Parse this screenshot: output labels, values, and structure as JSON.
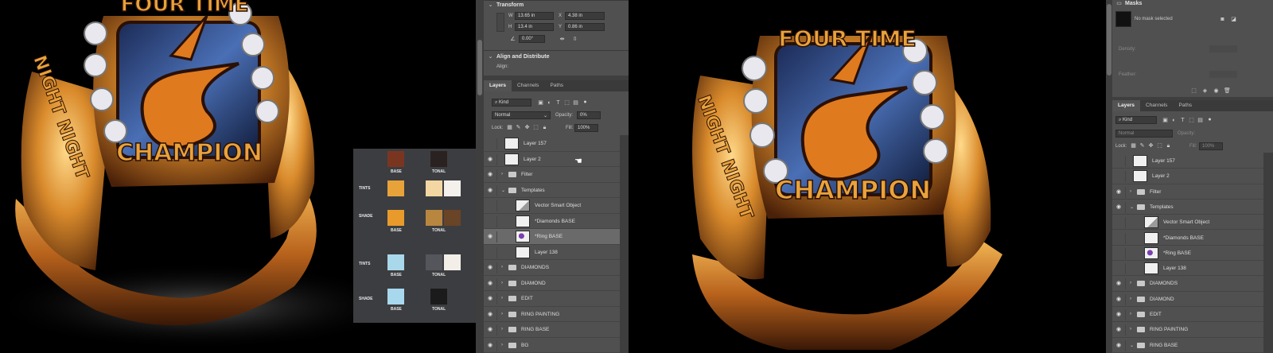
{
  "ring_text": {
    "top": "FOUR TIME",
    "bottom": "CHAMPION",
    "left_side": "NIGHT NIGHT"
  },
  "swatch_panel": {
    "row_labels": [
      "TINTS",
      "SHADE",
      "TINTS",
      "SHADE"
    ],
    "col_labels": [
      "BASE",
      "TONAL"
    ],
    "top_swatches": [
      "#7a3520",
      "#2a2220"
    ],
    "tints1": [
      "#e8a23a",
      "#f2d7a2",
      "#f4f1ec"
    ],
    "shade1": [
      "#e89b2a",
      "#b9863f",
      "#6a4426"
    ],
    "tints2": [
      "#a9d8ea",
      "#55565c",
      "#f3efe8"
    ],
    "shade2": [
      "#a8d8ee",
      "#1c1b1b"
    ]
  },
  "panel_a": {
    "transform_title": "Transform",
    "w_label": "W",
    "w_value": "13.65 in",
    "x_label": "X",
    "x_value": "4.38 in",
    "h_label": "H",
    "h_value": "13.4 in",
    "y_label": "Y",
    "y_value": "0.86 in",
    "angle_value": "0.00°",
    "align_title": "Align and Distribute",
    "align_label": "Align:",
    "tabs": [
      "Layers",
      "Channels",
      "Paths"
    ],
    "kind_label": "Kind",
    "blend_mode": "Normal",
    "opacity_label": "Opacity:",
    "opacity_value": "0%",
    "lock_label": "Lock:",
    "fill_label": "Fill:",
    "fill_value": "100%",
    "layers": [
      {
        "name": "Layer 157",
        "type": "layer",
        "visible": false,
        "indent": 0
      },
      {
        "name": "Layer 2",
        "type": "layer",
        "visible": true,
        "indent": 0
      },
      {
        "name": "Filter",
        "type": "group",
        "visible": true,
        "indent": 0,
        "open": false
      },
      {
        "name": "Templates",
        "type": "group",
        "visible": true,
        "indent": 0,
        "open": true
      },
      {
        "name": "Vector Smart Object",
        "type": "smart",
        "visible": false,
        "indent": 1
      },
      {
        "name": "*Diamonds BASE",
        "type": "layer",
        "visible": false,
        "indent": 1
      },
      {
        "name": "*Ring BASE",
        "type": "ring",
        "visible": true,
        "indent": 1,
        "selected": true
      },
      {
        "name": "Layer 138",
        "type": "layer",
        "visible": false,
        "indent": 1
      },
      {
        "name": "DIAMONDS",
        "type": "group",
        "visible": true,
        "indent": 0,
        "open": false
      },
      {
        "name": "DIAMOND",
        "type": "group",
        "visible": true,
        "indent": 0,
        "open": false
      },
      {
        "name": "EDIT",
        "type": "group",
        "visible": true,
        "indent": 0,
        "open": false
      },
      {
        "name": "RING PAINTING",
        "type": "group",
        "visible": true,
        "indent": 0,
        "open": false
      },
      {
        "name": "RING BASE",
        "type": "group",
        "visible": true,
        "indent": 0,
        "open": false
      },
      {
        "name": "BG",
        "type": "group",
        "visible": true,
        "indent": 0,
        "open": false
      }
    ]
  },
  "panel_b": {
    "masks_title": "Masks",
    "mask_status": "No mask selected",
    "density_label": "Density:",
    "feather_label": "Feather:",
    "tabs": [
      "Layers",
      "Channels",
      "Paths"
    ],
    "kind_label": "Kind",
    "blend_mode": "Normal",
    "opacity_label": "Opacity:",
    "lock_label": "Lock:",
    "fill_label": "Fill:",
    "fill_value": "100%",
    "layers": [
      {
        "name": "Layer 157",
        "type": "layer",
        "visible": false,
        "indent": 0
      },
      {
        "name": "Layer 2",
        "type": "layer",
        "visible": false,
        "indent": 0
      },
      {
        "name": "Filter",
        "type": "group",
        "visible": true,
        "indent": 0,
        "open": false
      },
      {
        "name": "Templates",
        "type": "group",
        "visible": true,
        "indent": 0,
        "open": true
      },
      {
        "name": "Vector Smart Object",
        "type": "smart",
        "visible": false,
        "indent": 1
      },
      {
        "name": "*Diamonds BASE",
        "type": "layer",
        "visible": false,
        "indent": 1
      },
      {
        "name": "*Ring BASE",
        "type": "ring",
        "visible": false,
        "indent": 1
      },
      {
        "name": "Layer 138",
        "type": "layer",
        "visible": false,
        "indent": 1
      },
      {
        "name": "DIAMONDS",
        "type": "group",
        "visible": true,
        "indent": 0,
        "open": false
      },
      {
        "name": "DIAMOND",
        "type": "group",
        "visible": true,
        "indent": 0,
        "open": false
      },
      {
        "name": "EDIT",
        "type": "group",
        "visible": true,
        "indent": 0,
        "open": false
      },
      {
        "name": "RING PAINTING",
        "type": "group",
        "visible": true,
        "indent": 0,
        "open": false
      },
      {
        "name": "RING BASE",
        "type": "group",
        "visible": true,
        "indent": 0,
        "open": true
      }
    ]
  },
  "colors": {
    "gold": "#d98a2b",
    "gold_light": "#f7c56a",
    "gold_dark": "#6b3510",
    "panel_bg": "#505050",
    "selected_row": "#6a6a6a"
  }
}
